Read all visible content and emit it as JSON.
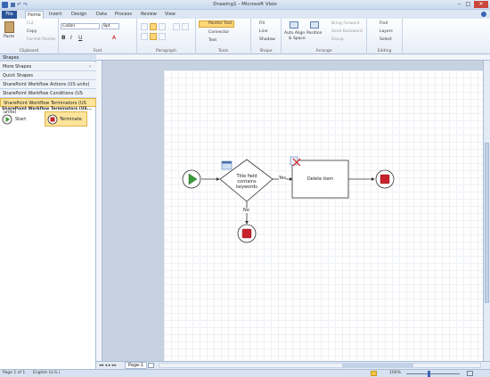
{
  "app": {
    "title": "Drawing1 - Microsoft Visio"
  },
  "tabs": [
    "File",
    "Home",
    "Insert",
    "Design",
    "Data",
    "Process",
    "Review",
    "View"
  ],
  "ribbon": {
    "clipboard": {
      "paste": "Paste",
      "cut": "Cut",
      "copy": "Copy",
      "format_painter": "Format Painter",
      "label": "Clipboard"
    },
    "font": {
      "family": "Calibri",
      "size": "8pt.",
      "label": "Font"
    },
    "paragraph": {
      "label": "Paragraph"
    },
    "tools": {
      "pointer": "Pointer Tool",
      "connector": "Connector",
      "text": "Text",
      "label": "Tools"
    },
    "shape": {
      "fill": "Fill",
      "line": "Line",
      "shadow": "Shadow",
      "label": "Shape"
    },
    "arrange": {
      "auto_align": "Auto Align",
      "and_space": "& Space",
      "position": "Position",
      "bring_forward": "Bring Forward",
      "send_backward": "Send Backward",
      "group": "Group",
      "label": "Arrange"
    },
    "editing": {
      "find": "Find",
      "layers": "Layers",
      "select": "Select",
      "label": "Editing"
    }
  },
  "shapes_panel": {
    "title": "Shapes",
    "rows": [
      "More Shapes",
      "Quick Shapes",
      "SharePoint Workflow Actions (US units)",
      "SharePoint Workflow Conditions (US units)",
      "SharePoint Workflow Terminators (US units)"
    ],
    "stencil_title": "SharePoint Workflow Terminators (US...",
    "items": [
      "Start",
      "Terminate"
    ]
  },
  "diagram": {
    "condition": "Title field contains keywords",
    "yes": "Yes",
    "no": "No",
    "action": "Delete item"
  },
  "page_tab": "Page-1",
  "status": {
    "page": "Page 1 of 1",
    "language": "English (U.S.)",
    "zoom": "100%"
  },
  "colors": {
    "accent": "#2b579a",
    "start_green": "#3a9a3a",
    "terminate_red": "#c8232c"
  }
}
